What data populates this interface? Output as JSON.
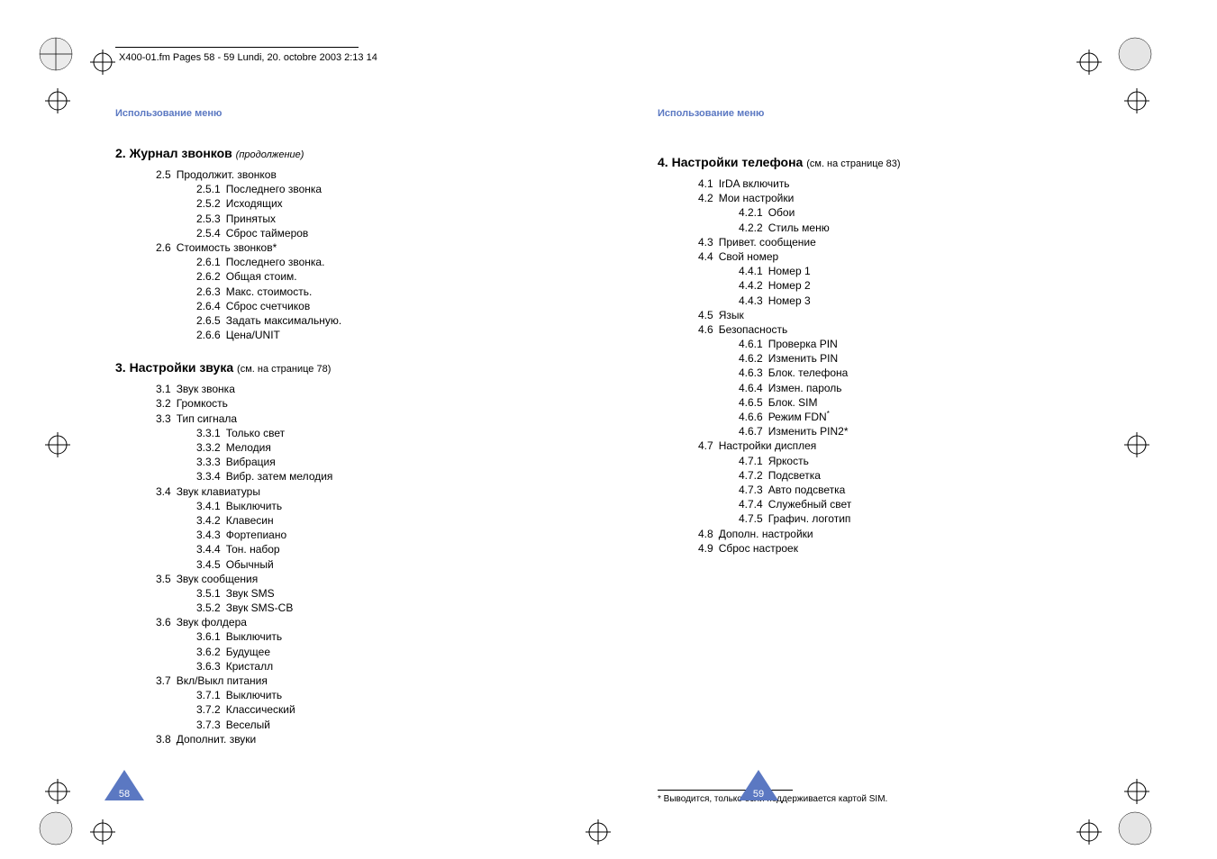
{
  "fm_header": "X400-01.fm  Pages 58 - 59  Lundi, 20. octobre 2003  2:13 14",
  "left": {
    "label": "Использование меню",
    "s2": {
      "num": "2.",
      "title": "Журнал звонков",
      "sub": "(продолжение)",
      "i1": {
        "n": "2.5",
        "t": "Продолжит. звонков"
      },
      "i1c": [
        {
          "n": "2.5.1",
          "t": "Последнего звонка"
        },
        {
          "n": "2.5.2",
          "t": "Исходящих"
        },
        {
          "n": "2.5.3",
          "t": "Принятых"
        },
        {
          "n": "2.5.4",
          "t": "Сброс таймеров"
        }
      ],
      "i2": {
        "n": "2.6",
        "t": "Стоимость звонков*"
      },
      "i2c": [
        {
          "n": "2.6.1",
          "t": "Последнего звонка."
        },
        {
          "n": "2.6.2",
          "t": "Общая стоим."
        },
        {
          "n": "2.6.3",
          "t": "Макс. стоимость."
        },
        {
          "n": "2.6.4",
          "t": "Сброс счетчиков"
        },
        {
          "n": "2.6.5",
          "t": "Задать максимальную."
        },
        {
          "n": "2.6.6",
          "t": "Цена/UNIT"
        }
      ]
    },
    "s3": {
      "num": "3.",
      "title": "Настройки звука",
      "sub": "(см. на странице 78)",
      "items": [
        {
          "n": "3.1",
          "t": "Звук звонка",
          "c": []
        },
        {
          "n": "3.2",
          "t": "Громкость",
          "c": []
        },
        {
          "n": "3.3",
          "t": "Тип сигнала",
          "c": [
            {
              "n": "3.3.1",
              "t": "Только свет"
            },
            {
              "n": "3.3.2",
              "t": "Мелодия"
            },
            {
              "n": "3.3.3",
              "t": "Вибрация"
            },
            {
              "n": "3.3.4",
              "t": "Вибр. затем мелодия"
            }
          ]
        },
        {
          "n": "3.4",
          "t": "Звук клавиатуры",
          "c": [
            {
              "n": "3.4.1",
              "t": "Выключить"
            },
            {
              "n": "3.4.2",
              "t": "Клавесин"
            },
            {
              "n": "3.4.3",
              "t": "Фортепиано"
            },
            {
              "n": "3.4.4",
              "t": "Тон. набор"
            },
            {
              "n": "3.4.5",
              "t": "Обычный"
            }
          ]
        },
        {
          "n": "3.5",
          "t": "Звук сообщения",
          "c": [
            {
              "n": "3.5.1",
              "t": "Звук SMS"
            },
            {
              "n": "3.5.2",
              "t": "Звук SMS-CB"
            }
          ]
        },
        {
          "n": "3.6",
          "t": "Звук фолдера",
          "c": [
            {
              "n": "3.6.1",
              "t": "Выключить"
            },
            {
              "n": "3.6.2",
              "t": "Будущее"
            },
            {
              "n": "3.6.3",
              "t": "Кристалл"
            }
          ]
        },
        {
          "n": "3.7",
          "t": "Вкл/Выкл питания",
          "c": [
            {
              "n": "3.7.1",
              "t": "Выключить"
            },
            {
              "n": "3.7.2",
              "t": "Классический"
            },
            {
              "n": "3.7.3",
              "t": "Веселый"
            }
          ]
        },
        {
          "n": "3.8",
          "t": "Дополнит. звуки",
          "c": []
        }
      ]
    },
    "page_num": "58"
  },
  "right": {
    "label": "Использование меню",
    "s4": {
      "num": "4.",
      "title": "Настройки телефона",
      "sub": "(см. на странице 83)",
      "items": [
        {
          "n": "4.1",
          "t": "IrDA включить",
          "c": []
        },
        {
          "n": "4.2",
          "t": "Мои настройки",
          "c": [
            {
              "n": "4.2.1",
              "t": "Обои"
            },
            {
              "n": "4.2.2",
              "t": "Стиль меню"
            }
          ]
        },
        {
          "n": "4.3",
          "t": "Привет. сообщение",
          "c": []
        },
        {
          "n": "4.4",
          "t": "Свой номер",
          "c": [
            {
              "n": "4.4.1",
              "t": "Номер 1"
            },
            {
              "n": "4.4.2",
              "t": "Номер 2"
            },
            {
              "n": "4.4.3",
              "t": "Номер 3"
            }
          ]
        },
        {
          "n": "4.5",
          "t": "Язык",
          "c": []
        },
        {
          "n": "4.6",
          "t": "Безопасность",
          "c": [
            {
              "n": "4.6.1",
              "t": "Проверка PIN"
            },
            {
              "n": "4.6.2",
              "t": "Изменить PIN"
            },
            {
              "n": "4.6.3",
              "t": "Блок. телефона"
            },
            {
              "n": "4.6.4",
              "t": "Измен. пароль"
            },
            {
              "n": "4.6.5",
              "t": "Блок. SIM"
            },
            {
              "n": "4.6.6",
              "t": "Режим FDN",
              "sup": "*"
            },
            {
              "n": "4.6.7",
              "t": "Изменить PIN2*"
            }
          ]
        },
        {
          "n": "4.7",
          "t": "Настройки дисплея",
          "c": [
            {
              "n": "4.7.1",
              "t": "Яркость"
            },
            {
              "n": "4.7.2",
              "t": "Подсветка"
            },
            {
              "n": "4.7.3",
              "t": "Авто подсветка"
            },
            {
              "n": "4.7.4",
              "t": "Служебный свет"
            },
            {
              "n": "4.7.5",
              "t": "Графич. логотип"
            }
          ]
        },
        {
          "n": "4.8",
          "t": "Дополн. настройки",
          "c": []
        },
        {
          "n": "4.9",
          "t": "Сброс настроек",
          "c": []
        }
      ]
    },
    "footnote": "* Выводится, только если поддерживается картой SIM.",
    "page_num": "59"
  }
}
